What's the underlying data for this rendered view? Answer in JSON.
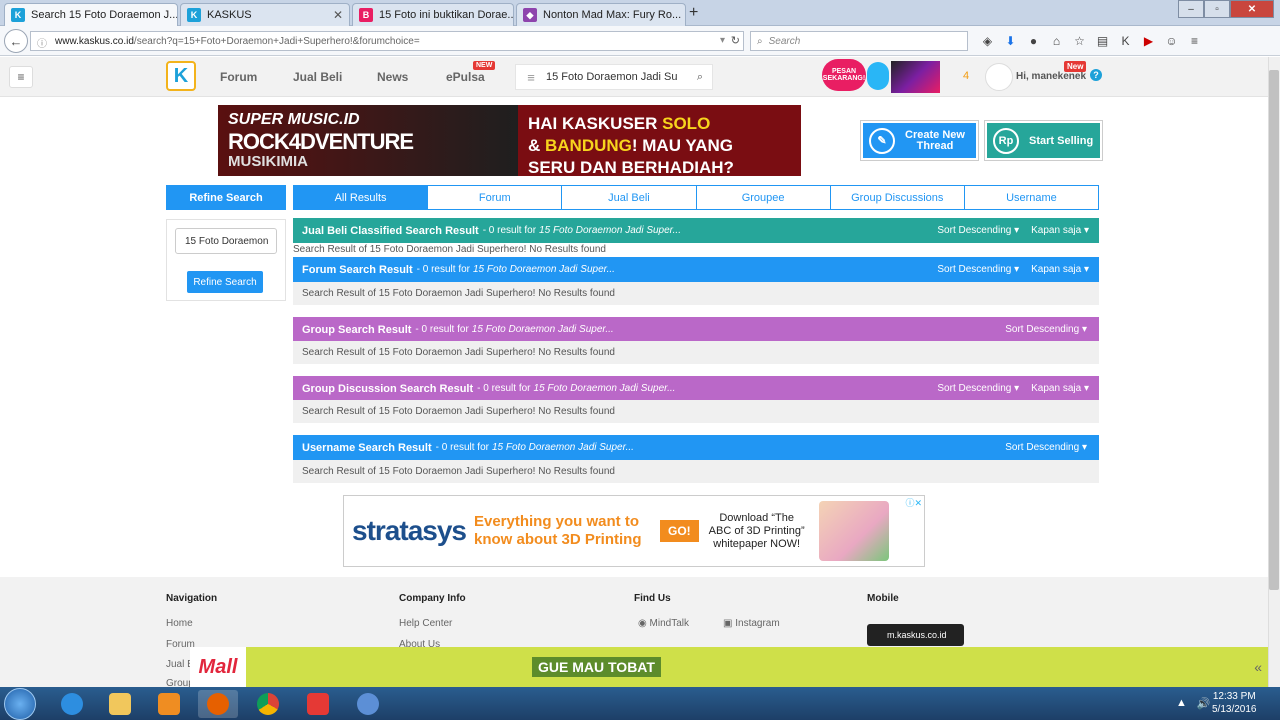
{
  "browser": {
    "tabs": [
      {
        "label": "Search 15 Foto Doraemon J...",
        "favicon": "kaskus-favicon",
        "active": true
      },
      {
        "label": "KASKUS",
        "favicon": "kaskus-favicon",
        "active": false
      },
      {
        "label": "15 Foto ini buktikan Dorae...",
        "favicon": "b-favicon",
        "active": false
      },
      {
        "label": "Nonton Mad Max: Fury Ro...",
        "favicon": "generic-favicon",
        "active": false
      }
    ],
    "new_tab": "+",
    "url_host": "www.kaskus.co.id",
    "url_path": "/search?q=15+Foto+Doraemon+Jadi+Superhero!&forumchoice=",
    "search_placeholder": "Search",
    "back": "←"
  },
  "header": {
    "nav": [
      "Forum",
      "Jual Beli",
      "News",
      "ePulsa"
    ],
    "epulsa_badge": "NEW",
    "search_value": "15 Foto Doraemon Jadi Su",
    "promo": "PESAN SEKARANG!",
    "notif_count": "4",
    "greeting": "Hi, manekenek",
    "user_badge": "New",
    "help": "?"
  },
  "banner": {
    "left_line1": "SUPER MUSIC.ID",
    "left_line2": "ROCK4DVENTURE",
    "left_line3": "MUSIKIMIA",
    "line1_a": "HAI KASKUSER ",
    "line1_b": "SOLO",
    "line2_a": "& ",
    "line2_b": "BANDUNG",
    "line2_c": "! MAU YANG",
    "line3": "SERU DAN BERHADIAH?"
  },
  "actions": {
    "create_thread": "Create New Thread",
    "start_selling": "Start Selling",
    "rp": "Rp"
  },
  "refine": {
    "title": "Refine Search",
    "input_value": "15 Foto Doraemon",
    "button": "Refine Search"
  },
  "result_tabs": [
    "All Results",
    "Forum",
    "Jual Beli",
    "Groupee",
    "Group Discussions",
    "Username"
  ],
  "sections": [
    {
      "title": "Jual Beli Classified Search Result",
      "count": "- 0 result for",
      "query": "15 Foto Doraemon Jadi Super...",
      "sort": "Sort Descending",
      "time": "Kapan saja",
      "color": "#26a69a",
      "message": "Search Result of 15 Foto Doraemon Jadi Superhero! No Results found"
    },
    {
      "title": "Forum Search Result",
      "count": "- 0 result for",
      "query": "15 Foto Doraemon Jadi Super...",
      "sort": "Sort Descending",
      "time": "Kapan saja",
      "color": "#2196f3",
      "message": "Search Result of 15 Foto Doraemon Jadi Superhero! No Results found"
    },
    {
      "title": "Group Search Result",
      "count": "- 0 result for",
      "query": "15 Foto Doraemon Jadi Super...",
      "sort": "Sort Descending",
      "time": "",
      "color": "#ba68c8",
      "message": "Search Result of 15 Foto Doraemon Jadi Superhero! No Results found"
    },
    {
      "title": "Group Discussion Search Result",
      "count": "- 0 result for",
      "query": "15 Foto Doraemon Jadi Super...",
      "sort": "Sort Descending",
      "time": "Kapan saja",
      "color": "#ba68c8",
      "message": "Search Result of 15 Foto Doraemon Jadi Superhero! No Results found"
    },
    {
      "title": "Username Search Result",
      "count": "- 0 result for",
      "query": "15 Foto Doraemon Jadi Super...",
      "sort": "Sort Descending",
      "time": "",
      "color": "#2196f3",
      "message": "Search Result of 15 Foto Doraemon Jadi Superhero! No Results found"
    }
  ],
  "ad": {
    "brand": "stratasys",
    "message": "Everything you want to know about 3D Printing",
    "go": "GO!",
    "download": "Download “The ABC of 3D Printing” whitepaper NOW!"
  },
  "footer": {
    "navigation_title": "Navigation",
    "navigation": [
      "Home",
      "Forum",
      "Jual B",
      "Group"
    ],
    "company_title": "Company Info",
    "company": [
      "Help Center",
      "About Us"
    ],
    "findus_title": "Find Us",
    "findus": [
      "MindTalk",
      "Instagram"
    ],
    "mobile_title": "Mobile",
    "mobile": "m.kaskus.co.id"
  },
  "bottom_ad": {
    "mall": "Mall",
    "message": "GUE MAU TOBAT",
    "chevron": "«"
  },
  "taskbar": {
    "time": "12:33 PM",
    "date": "5/13/2016"
  }
}
